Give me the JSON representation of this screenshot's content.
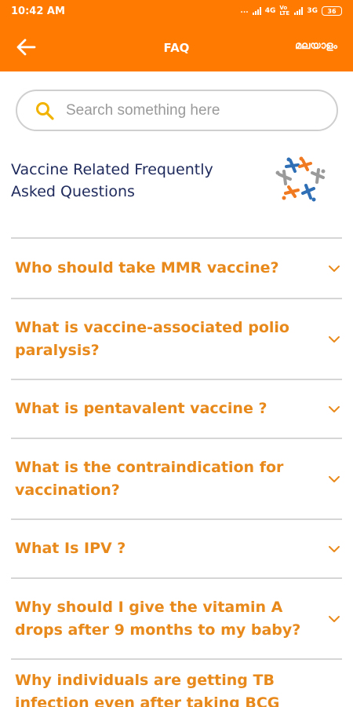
{
  "status_bar": {
    "time": "10:42 AM",
    "dots": "...",
    "net1": "4G",
    "volte": "Vo LTE",
    "net2": "3G",
    "battery": "36"
  },
  "app_bar": {
    "title": "FAQ",
    "language_label": "മലയാളം"
  },
  "search": {
    "placeholder": "Search something here",
    "value": ""
  },
  "section": {
    "title_line1": "Vaccine Related Frequently",
    "title_line2": "Asked Questions"
  },
  "faqs": [
    {
      "question_line1": "Who should take MMR vaccine?",
      "question_line2": ""
    },
    {
      "question_line1": "What is vaccine-associated polio",
      "question_line2": "paralysis?"
    },
    {
      "question_line1": "What is pentavalent vaccine ?",
      "question_line2": ""
    },
    {
      "question_line1": "What is the contraindication for",
      "question_line2": "vaccination?"
    },
    {
      "question_line1": "What Is IPV ?",
      "question_line2": ""
    },
    {
      "question_line1": "Why should I give the vitamin A",
      "question_line2": "drops after 9 months to my baby?"
    },
    {
      "question_line1": "Why individuals are getting TB",
      "question_line2": "infection even after taking BCG"
    }
  ],
  "colors": {
    "primary": "#ff7a00",
    "question_text": "#e8891b",
    "heading_text": "#1f2a5c",
    "divider": "#d6d6d6"
  },
  "icons": [
    "back-arrow-icon",
    "search-icon",
    "chevron-down-icon",
    "vaccine-logo-icon",
    "signal-icon",
    "battery-icon"
  ]
}
